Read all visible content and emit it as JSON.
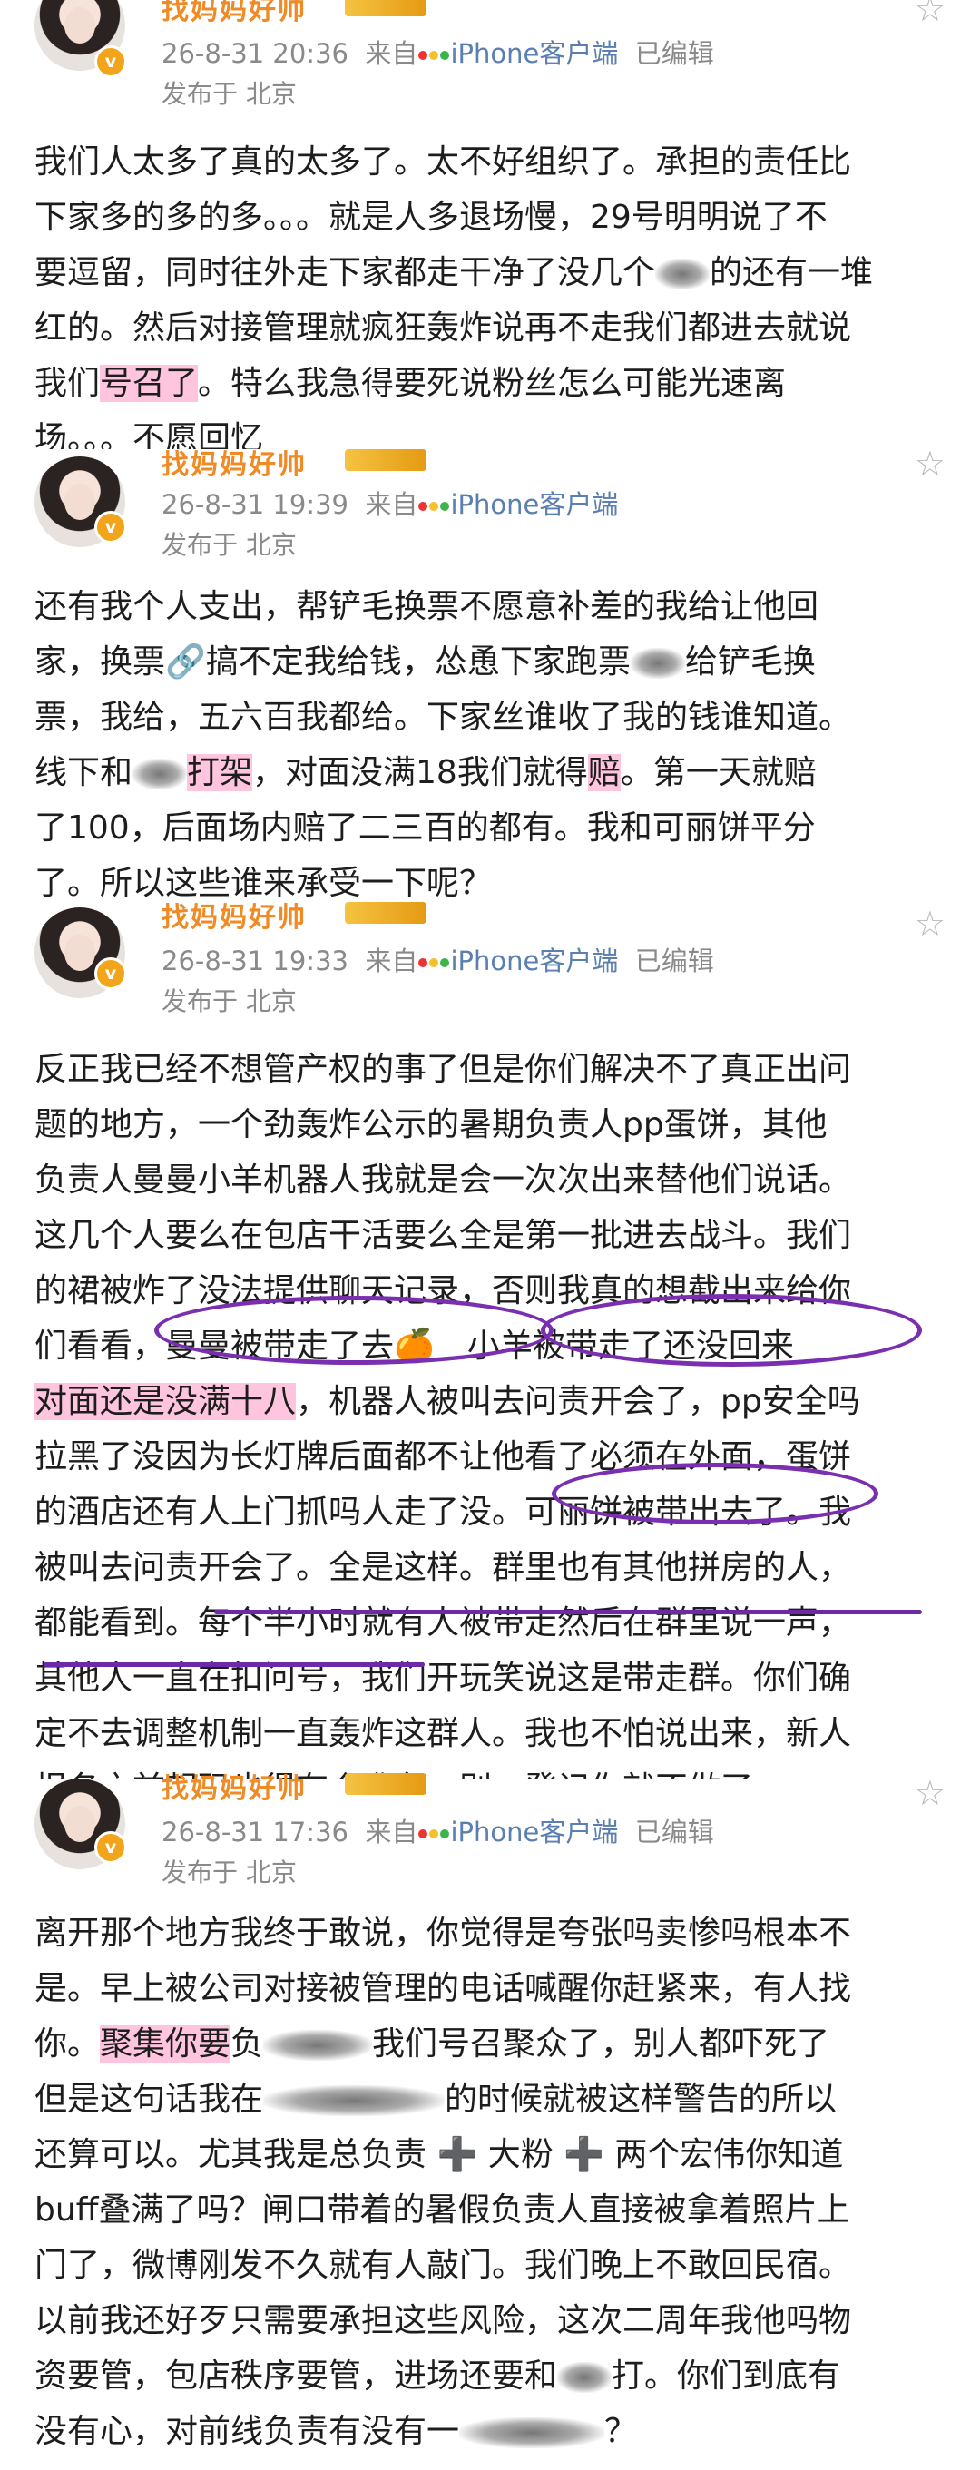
{
  "posts": [
    {
      "author": "找妈妈好帅",
      "time": "26-8-31 20:36",
      "source_prefix": "来自",
      "client": "iPhone客户端",
      "edited": "已编辑",
      "location": "发布于 北京",
      "lines": [
        "我们人太多了真的太多了。太不好组织了。承担的责任比",
        "下家多的多的多。。。就是人多退场慢，29号明明说了不",
        "要逗留，同时往外走下家都走干净了没几个",
        "的还有一堆",
        "红的。然后对接管理就疯狂轰炸说再不走我们都进去就说",
        "我们",
        "号召了",
        "。特么我急得要死说粉丝怎么可能光速离",
        "场。。。不愿回忆"
      ]
    },
    {
      "author": "找妈妈好帅",
      "time": "26-8-31 19:39",
      "source_prefix": "来自",
      "client": "iPhone客户端",
      "edited": "",
      "location": "发布于 北京",
      "lines": [
        "还有我个人支出，帮铲毛换票不愿意补差的我给让他回",
        "家，换票🔗搞不定我给钱，怂恿下家跑票",
        "给铲毛换",
        "票，我给，五六百我都给。下家丝谁收了我的钱谁知道。",
        "线下和",
        "打架",
        "，对面没满18我们就得",
        "赔",
        "。第一天就赔",
        "了100，后面场内赔了二三百的都有。我和可丽饼平分",
        "了。所以这些谁来承受一下呢？"
      ]
    },
    {
      "author": "找妈妈好帅",
      "time": "26-8-31 19:33",
      "source_prefix": "来自",
      "client": "iPhone客户端",
      "edited": "已编辑",
      "location": "发布于 北京",
      "lines": [
        "反正我已经不想管产权的事了但是你们解决不了真正出问",
        "题的地方，一个劲轰炸公示的暑期负责人pp蛋饼，其他",
        "负责人曼曼小羊机器人我就是会一次次出来替他们说话。",
        "这几个人要么在包店干活要么全是第一批进去战斗。我们",
        "的裙被炸了没法提供聊天记录，否则我真的想截出来给你",
        "们看看，曼曼被带走了去🍊",
        "小羊被带走了还没回来",
        "对面还是没满十八",
        "，机器人被叫去问责开会了，pp安全吗",
        "拉黑了没因为长灯牌后面都不让他看了必须在外面，蛋饼",
        "的酒店还有人上门抓吗人走了没。可丽饼被带出去了。我",
        "被叫去问责开会了。全是这样。群里也有其他拼房的人，",
        "都能看到。每个半小时就有人被带走然后在群里说一声，",
        "其他人一直在扣问号，我们开玩笑说这是带走群。你们确",
        "定不去调整机制一直轰炸这群人。我也不怕说出来，新人",
        "报名之前起码也得有个准备，别一登记你就不做了。"
      ]
    },
    {
      "author": "找妈妈好帅",
      "time": "26-8-31 17:36",
      "source_prefix": "来自",
      "client": "iPhone客户端",
      "edited": "已编辑",
      "location": "发布于 北京",
      "lines": [
        "离开那个地方我终于敢说，你觉得是夸张吗卖惨吗根本不",
        "是。早上被公司对接被管理的电话喊醒你赶紧来，有人找",
        "你。",
        "聚集你要",
        "负",
        "我们号召聚众了，别人都吓死了",
        "但是这句话我在",
        "的时候就被这样警告的所以",
        "还算可以。尤其我是总负责 ➕ 大粉 ➕ 两个宏伟你知道",
        "buff叠满了吗？闸口带着的暑假负责人直接被拿着照片上",
        "门了，微博刚发不久就有人敲门。我们晚上不敢回民宿。",
        "以前我还好歹只需要承担这些风险，这次二周年我他吗物",
        "资要管，包店秩序要管，进场还要和",
        "打。你们到底有",
        "没有心，对前线负责有没有一",
        "？"
      ]
    }
  ],
  "colors": {
    "accent": "#f08a24",
    "client": "#5a7fb0",
    "highlight": "#ff5aa0",
    "circle": "#7a2fb0"
  }
}
